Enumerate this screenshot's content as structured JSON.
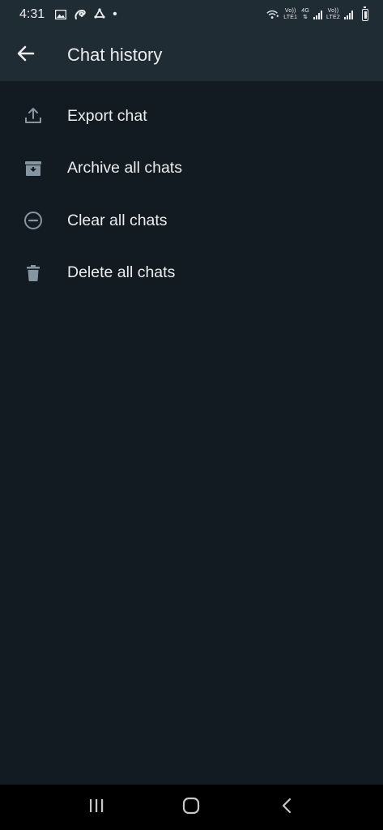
{
  "status_bar": {
    "time": "4:31",
    "network1": {
      "top": "Vo))",
      "bottom": "LTE1"
    },
    "network_type": "4G",
    "network2": {
      "top": "Vo))",
      "bottom": "LTE2"
    }
  },
  "app_bar": {
    "title": "Chat history",
    "back_icon": "arrow-left-icon"
  },
  "menu": {
    "items": [
      {
        "label": "Export chat",
        "icon": "upload-icon"
      },
      {
        "label": "Archive all chats",
        "icon": "archive-icon"
      },
      {
        "label": "Clear all chats",
        "icon": "minus-circle-icon"
      },
      {
        "label": "Delete all chats",
        "icon": "trash-icon"
      }
    ]
  },
  "nav_bar": {
    "buttons": [
      "recent-apps-icon",
      "home-icon",
      "back-icon"
    ]
  },
  "colors": {
    "background": "#121b22",
    "app_bar": "#1f2c34",
    "text": "#e9edef",
    "icon": "#8696a0"
  }
}
